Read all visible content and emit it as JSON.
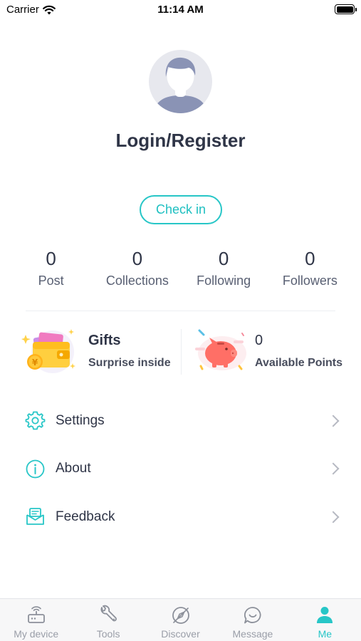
{
  "status_bar": {
    "carrier": "Carrier",
    "time": "11:14 AM"
  },
  "profile": {
    "login_label": "Login/Register",
    "checkin_label": "Check in"
  },
  "stats": [
    {
      "value": "0",
      "label": "Post"
    },
    {
      "value": "0",
      "label": "Collections"
    },
    {
      "value": "0",
      "label": "Following"
    },
    {
      "value": "0",
      "label": "Followers"
    }
  ],
  "cards": {
    "gifts": {
      "title": "Gifts",
      "subtitle": "Surprise inside",
      "icon": "gift-wallet-icon"
    },
    "points": {
      "value": "0",
      "subtitle": "Available Points",
      "icon": "piggy-bank-icon"
    }
  },
  "menu": [
    {
      "label": "Settings",
      "icon": "gear-icon"
    },
    {
      "label": "About",
      "icon": "info-icon"
    },
    {
      "label": "Feedback",
      "icon": "feedback-icon"
    }
  ],
  "tabs": [
    {
      "label": "My device",
      "icon": "router-icon"
    },
    {
      "label": "Tools",
      "icon": "wrench-icon"
    },
    {
      "label": "Discover",
      "icon": "compass-icon"
    },
    {
      "label": "Message",
      "icon": "chat-icon"
    },
    {
      "label": "Me",
      "icon": "person-icon",
      "active": true
    }
  ],
  "colors": {
    "accent": "#27c6c7",
    "text": "#2f3547",
    "muted": "#9a9ea8"
  }
}
